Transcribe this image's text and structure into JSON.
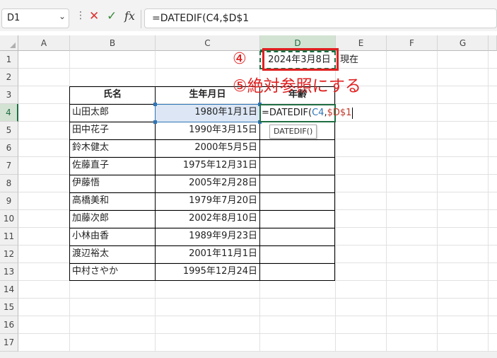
{
  "name_box": "D1",
  "formula_text": "=DATEDIF(C4,$D$1",
  "fx_label": "fx",
  "columns": [
    "A",
    "B",
    "C",
    "D",
    "E",
    "F",
    "G"
  ],
  "rows": [
    "1",
    "2",
    "3",
    "4",
    "5",
    "6",
    "7",
    "8",
    "9",
    "10",
    "11",
    "12",
    "13",
    "14",
    "15",
    "16",
    "17"
  ],
  "cell_D1": "2024年3月8日",
  "cell_E1": "現在",
  "annotation_4": "④",
  "annotation_5": "⑤絶対参照にする",
  "table": {
    "header_name": "氏名",
    "header_birth": "生年月日",
    "header_age": "年齢",
    "rows": [
      {
        "name": "山田太郎",
        "birth": "1980年1月1日"
      },
      {
        "name": "田中花子",
        "birth": "1990年3月15日"
      },
      {
        "name": "鈴木健太",
        "birth": "2000年5月5日"
      },
      {
        "name": "佐藤直子",
        "birth": "1975年12月31日"
      },
      {
        "name": "伊藤悟",
        "birth": "2005年2月28日"
      },
      {
        "name": "高橋美和",
        "birth": "1979年7月20日"
      },
      {
        "name": "加藤次郎",
        "birth": "2002年8月10日"
      },
      {
        "name": "小林由香",
        "birth": "1989年9月23日"
      },
      {
        "name": "渡辺裕太",
        "birth": "2001年11月1日"
      },
      {
        "name": "中村さやか",
        "birth": "1995年12月24日"
      }
    ]
  },
  "edit_cell": {
    "prefix": "=DATEDIF(",
    "ref1": "C4",
    "comma": ",",
    "ref2": "$D$1"
  },
  "tooltip": "DATEDIF()",
  "colors": {
    "ref1": "#2e75b6",
    "ref2": "#c0392b",
    "annotation": "#e02020",
    "selected": "#1f6e43"
  }
}
